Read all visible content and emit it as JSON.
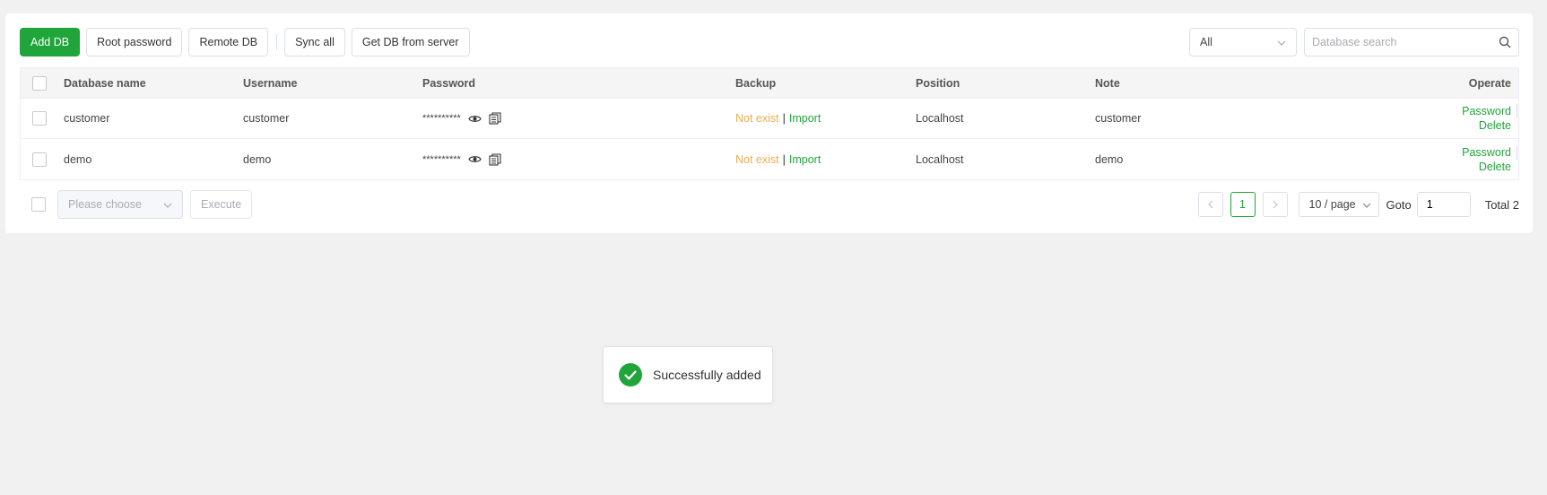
{
  "toolbar": {
    "add_db": "Add DB",
    "root_password": "Root password",
    "remote_db": "Remote DB",
    "sync_all": "Sync all",
    "get_db_from_server": "Get DB from server"
  },
  "filter": {
    "selected": "All"
  },
  "search": {
    "placeholder": "Database search"
  },
  "table": {
    "columns": [
      "Database name",
      "Username",
      "Password",
      "Backup",
      "Position",
      "Note",
      "Operate"
    ],
    "rows": [
      {
        "name": "customer",
        "username": "customer",
        "password_mask": "**********",
        "backup_status": "Not exist",
        "backup_action": "Import",
        "position": "Localhost",
        "note": "customer",
        "op_password": "Password",
        "op_delete": "Delete"
      },
      {
        "name": "demo",
        "username": "demo",
        "password_mask": "**********",
        "backup_status": "Not exist",
        "backup_action": "Import",
        "position": "Localhost",
        "note": "demo",
        "op_password": "Password",
        "op_delete": "Delete"
      }
    ],
    "pipe": "|"
  },
  "footer": {
    "batch_placeholder": "Please choose",
    "execute": "Execute",
    "current_page": "1",
    "page_size": "10 / page",
    "goto_label": "Goto",
    "goto_value": "1",
    "total": "Total 2"
  },
  "toast": {
    "message": "Successfully added"
  },
  "colors": {
    "accent": "#20a53a",
    "warning": "#f0ad4e"
  },
  "icons": [
    "chevron-down-icon",
    "search-icon",
    "eye-icon",
    "copy-icon",
    "chevron-left-icon",
    "chevron-right-icon",
    "check-circle-icon"
  ]
}
